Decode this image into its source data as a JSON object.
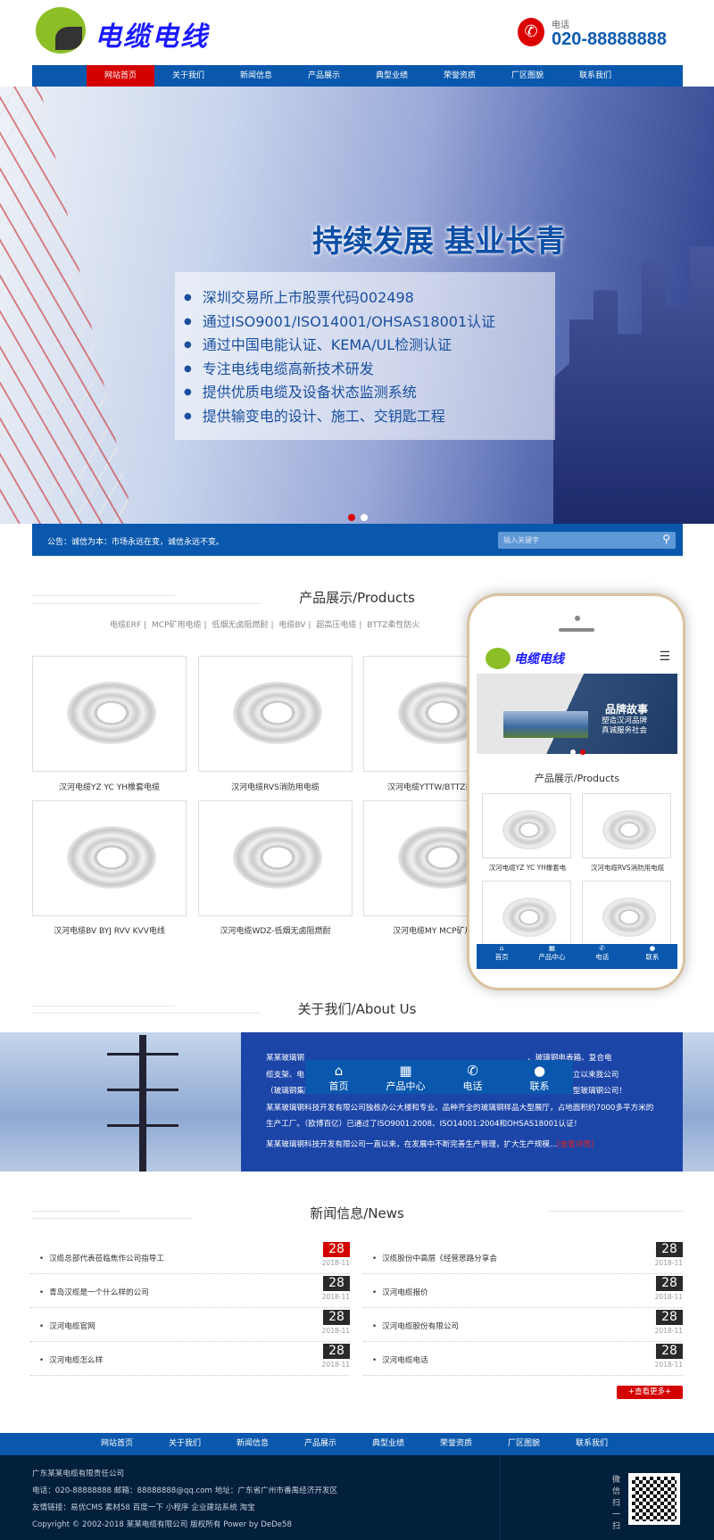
{
  "header": {
    "logo_text": "电缆电线",
    "phone_label": "电话",
    "phone_number": "020-88888888"
  },
  "nav": {
    "items": [
      "网站首页",
      "关于我们",
      "新闻信息",
      "产品展示",
      "典型业绩",
      "荣誉资质",
      "厂区图貌",
      "联系我们"
    ],
    "active": 0
  },
  "banner": {
    "slogan": "持续发展 基业长青",
    "bullets": [
      "深圳交易所上市股票代码002498",
      "通过ISO9001/ISO14001/OHSAS18001认证",
      "通过中国电能认证、KEMA/UL检测认证",
      "专注电线电缆高新技术研发",
      "提供优质电缆及设备状态监测系统",
      "提供输变电的设计、施工、交钥匙工程"
    ],
    "slide_count": 2,
    "active_slide": 0
  },
  "notice": {
    "text": "公告：诚信为本：市场永远在变，诚信永远不变。",
    "search_placeholder": "输入关键字"
  },
  "products": {
    "title": "产品展示/Products",
    "categories": [
      "电缆ERF",
      "MCP矿用电缆",
      "低烟无卤阻燃耐",
      "电缆BV",
      "超高压电缆",
      "BTTZ柔性防火"
    ],
    "items": [
      "汉河电缆YZ YC YH橡套电缆",
      "汉河电缆RVS消防用电缆",
      "汉河电缆YTTW/BTTZ柔",
      "汉河电缆BV BYJ RVV KVV电线",
      "汉河电缆WDZ-低烟无卤阻燃耐",
      "汉河电缆MY MCP矿用"
    ]
  },
  "mobile": {
    "logo_text": "电缆电线",
    "banner_title": "品牌故事",
    "banner_sub1": "塑造汉河品牌",
    "banner_sub2": "真诚服务社会",
    "section_title": "产品展示/Products",
    "items": [
      "汉河电缆YZ YC YH橡套电",
      "汉河电缆RVS消防用电缆"
    ],
    "nav": [
      "首页",
      "产品中心",
      "电话",
      "联系"
    ]
  },
  "about": {
    "title": "关于我们/About Us",
    "lines": [
      "某某玻璃钢",
      "、玻璃钢电表箱、复合电",
      "缆支架、电",
      "箱自成立以来我公司",
      "（玻璃钢集团）就取得了良好的优异成绩，早下来多个玻璃钢制品专利是当地首屈一指的大型玻璃钢公司！",
      "某某玻璃钢科技开发有限公司独栋办公大楼和专业、品种齐全的玻璃钢样品大型展厅，占地面积约7000多平方米的",
      "生产工厂。（欧博百亿）已通过了ISO9001:2008、ISO14001:2004和OHSAS18001认证！",
      "某某玻璃钢科技开发有限公司一直以来，在发展中不断完善生产管理，扩大生产规模..."
    ],
    "more": "[查看详情]"
  },
  "news": {
    "title": "新闻信息/News",
    "left": [
      {
        "title": "汉缆总部代表莅临焦作公司指导工",
        "day": "28",
        "month": "2018-11"
      },
      {
        "title": "青岛汉缆是一个什么样的公司",
        "day": "28",
        "month": "2018-11"
      },
      {
        "title": "汉河电缆官网",
        "day": "28",
        "month": "2018-11"
      },
      {
        "title": "汉河电缆怎么样",
        "day": "28",
        "month": "2018-11"
      }
    ],
    "right": [
      {
        "title": "汉缆股份中高层《经营思路分享会",
        "day": "28",
        "month": "2018-11"
      },
      {
        "title": "汉河电缆报价",
        "day": "28",
        "month": "2018-11"
      },
      {
        "title": "汉河电缆股份有限公司",
        "day": "28",
        "month": "2018-11"
      },
      {
        "title": "汉河电缆电话",
        "day": "28",
        "month": "2018-11"
      }
    ],
    "more": "+查看更多+"
  },
  "footer": {
    "nav": [
      "网站首页",
      "关于我们",
      "新闻信息",
      "产品展示",
      "典型业绩",
      "荣誉资质",
      "厂区图貌",
      "联系我们"
    ],
    "company": "广东某某电缆有限责任公司",
    "contact": "电话：020-88888888  邮箱：88888888@qq.com  地址：广东省广州市番禺经济开发区",
    "links": "友情链接：易优CMS 素材58 百度一下 小程序 企业建站系统 淘宝",
    "copyright": "Copyright © 2002-2018 某某电缆有限公司 版权所有 Power by DeDe58",
    "wechat": "微信扫一扫"
  },
  "colors": {
    "primary": "#0a58ad",
    "accent": "#d40000",
    "footer": "#021f3c"
  }
}
